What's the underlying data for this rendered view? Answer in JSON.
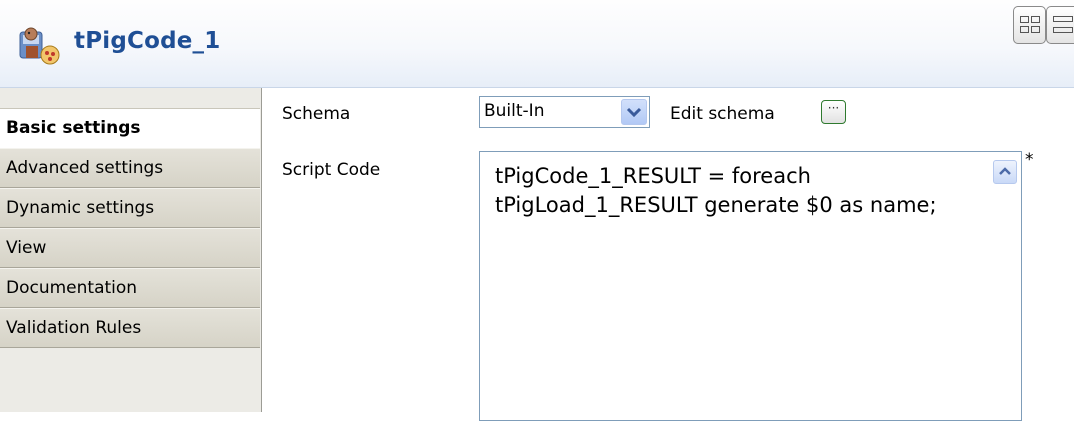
{
  "header": {
    "title": "tPigCode_1",
    "icon": "pig-component-icon"
  },
  "toolbar": {
    "buttons": [
      {
        "icon": "grid-layout-icon"
      },
      {
        "icon": "list-layout-icon"
      }
    ]
  },
  "sidebar": {
    "tabs": [
      {
        "label": "Basic settings",
        "active": true
      },
      {
        "label": "Advanced settings",
        "active": false
      },
      {
        "label": "Dynamic settings",
        "active": false
      },
      {
        "label": "View",
        "active": false
      },
      {
        "label": "Documentation",
        "active": false
      },
      {
        "label": "Validation Rules",
        "active": false
      }
    ]
  },
  "form": {
    "schema_label": "Schema",
    "schema_value": "Built-In",
    "edit_schema_label": "Edit schema",
    "edit_schema_button": "···",
    "script_code_label": "Script Code",
    "script_code_lines": [
      "tPigCode_1_RESULT = foreach",
      "tPigLoad_1_RESULT generate $0 as name;"
    ],
    "required_marker": "*"
  },
  "colors": {
    "title": "#1f4f95",
    "header_bg": "#f2f6fc",
    "sidebar_bg": "#ecebe6",
    "field_border": "#7f9db9"
  }
}
